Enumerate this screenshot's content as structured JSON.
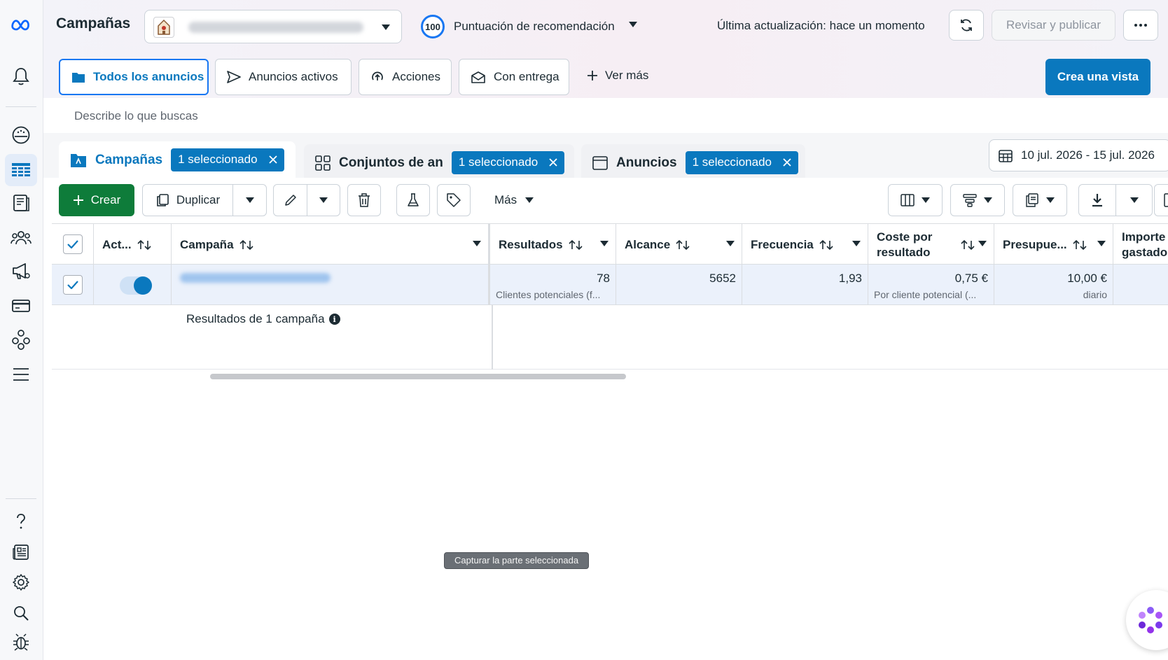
{
  "header": {
    "title": "Campañas",
    "score_value": "100",
    "score_label": "Puntuación de recomendación",
    "last_update": "Última actualización: hace un momento",
    "publish_label": "Revisar y publicar"
  },
  "view_tabs": [
    {
      "label": "Todos los anuncios",
      "icon": "folder-icon",
      "active": true
    },
    {
      "label": "Anuncios activos",
      "icon": "send-icon",
      "active": false
    },
    {
      "label": "Acciones",
      "icon": "action-icon",
      "active": false
    },
    {
      "label": "Con entrega",
      "icon": "envelope-icon",
      "active": false
    }
  ],
  "see_more_label": "Ver más",
  "create_view_label": "Crea una vista",
  "search": {
    "placeholder": "Describe lo que buscas"
  },
  "level_tabs": [
    {
      "label": "Campañas",
      "chip": "1 seleccionado"
    },
    {
      "label": "Conjuntos de an",
      "chip": "1 seleccionado"
    },
    {
      "label": "Anuncios",
      "chip": "1 seleccionado"
    }
  ],
  "date_range": "10 jul. 2026 - 15 jul. 2026",
  "toolbar": {
    "create": "Crear",
    "duplicate": "Duplicar",
    "more": "Más"
  },
  "columns": [
    {
      "label": "Act..."
    },
    {
      "label": "Campaña"
    },
    {
      "label": "Resultados"
    },
    {
      "label": "Alcance"
    },
    {
      "label": "Frecuencia"
    },
    {
      "label": "Coste por resultado"
    },
    {
      "label": "Presupue..."
    },
    {
      "label": "Importe gastado"
    }
  ],
  "row": {
    "results": "78",
    "results_sub": "Clientes potenciales (f...",
    "reach": "5652",
    "frequency": "1,93",
    "cost": "0,75 €",
    "cost_sub": "Por cliente potencial (...",
    "budget": "10,00 €",
    "budget_sub": "diario"
  },
  "summary": "Resultados de 1 campaña",
  "tooltip": "Capturar la parte seleccionada",
  "colors": {
    "accent": "#0a78be",
    "create": "#0e7c3a",
    "row_selected": "#ebf1fb"
  }
}
